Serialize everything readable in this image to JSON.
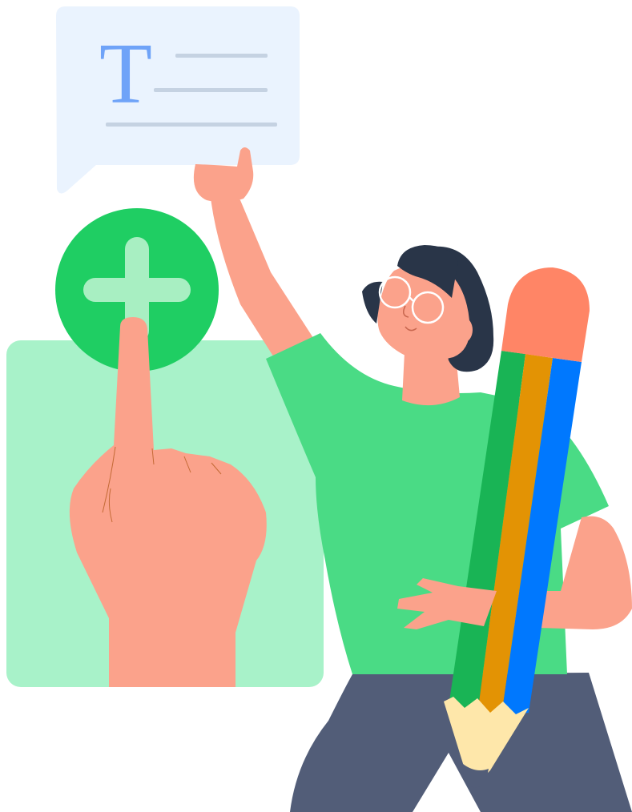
{
  "speech_bubble": {
    "glyph": "T"
  },
  "icons": {
    "add": "plus-icon",
    "text": "text-format-icon",
    "pencil": "pencil-icon",
    "hand": "pointing-hand-icon"
  },
  "colors": {
    "bubble": "#EAF3FE",
    "text_glyph": "#6FA3F8",
    "text_lines": "#C5D2E2",
    "add_circle": "#1FCE63",
    "add_plus": "#A8EFC2",
    "panel": "#A8F2C9",
    "skin": "#FBA28B",
    "shirt": "#4ADB85",
    "pants": "#525D78",
    "hair": "#293548",
    "pencil_green": "#19B455",
    "pencil_orange": "#E39304",
    "pencil_blue": "#0078FE",
    "pencil_eraser": "#FF8566",
    "pencil_wood": "#FEE7AA"
  }
}
